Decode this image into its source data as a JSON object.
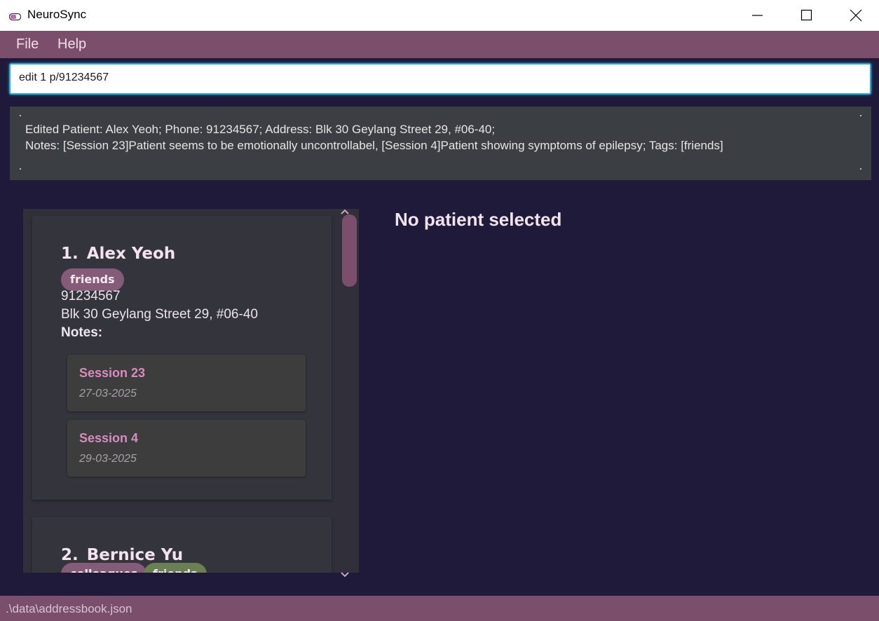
{
  "window": {
    "title": "NeuroSync",
    "controls": [
      "minimize-icon",
      "maximize-icon",
      "close-icon"
    ]
  },
  "menu": {
    "file": "File",
    "help": "Help"
  },
  "command": {
    "value": "edit 1 p/91234567"
  },
  "result": {
    "line1": "Edited Patient: Alex Yeoh; Phone: 91234567; Address: Blk 30 Geylang Street 29, #06-40;",
    "line2": "Notes: [Session 23]Patient seems to be emotionally uncontrollabel, [Session 4]Patient showing symptoms of epilepsy; Tags: [friends]"
  },
  "patients": [
    {
      "index": "1.",
      "name": "Alex Yeoh",
      "tags": [
        "friends"
      ],
      "phone": "91234567",
      "address": "Blk 30 Geylang Street 29, #06-40",
      "notes_label": "Notes:",
      "notes": [
        {
          "title": "Session 23",
          "date": "27-03-2025"
        },
        {
          "title": "Session 4",
          "date": "29-03-2025"
        }
      ]
    },
    {
      "index": "2.",
      "name": "Bernice Yu",
      "tags": [
        "colleagues",
        "friends"
      ]
    }
  ],
  "detail": {
    "title": "No patient selected"
  },
  "status": {
    "path": ".\\data\\addressbook.json"
  },
  "colors": {
    "accent": "#7b4e6c",
    "background": "#201a3a",
    "note_title": "#d98bbd",
    "tag_purple": "#855b7a",
    "tag_green": "#6b7f55"
  }
}
